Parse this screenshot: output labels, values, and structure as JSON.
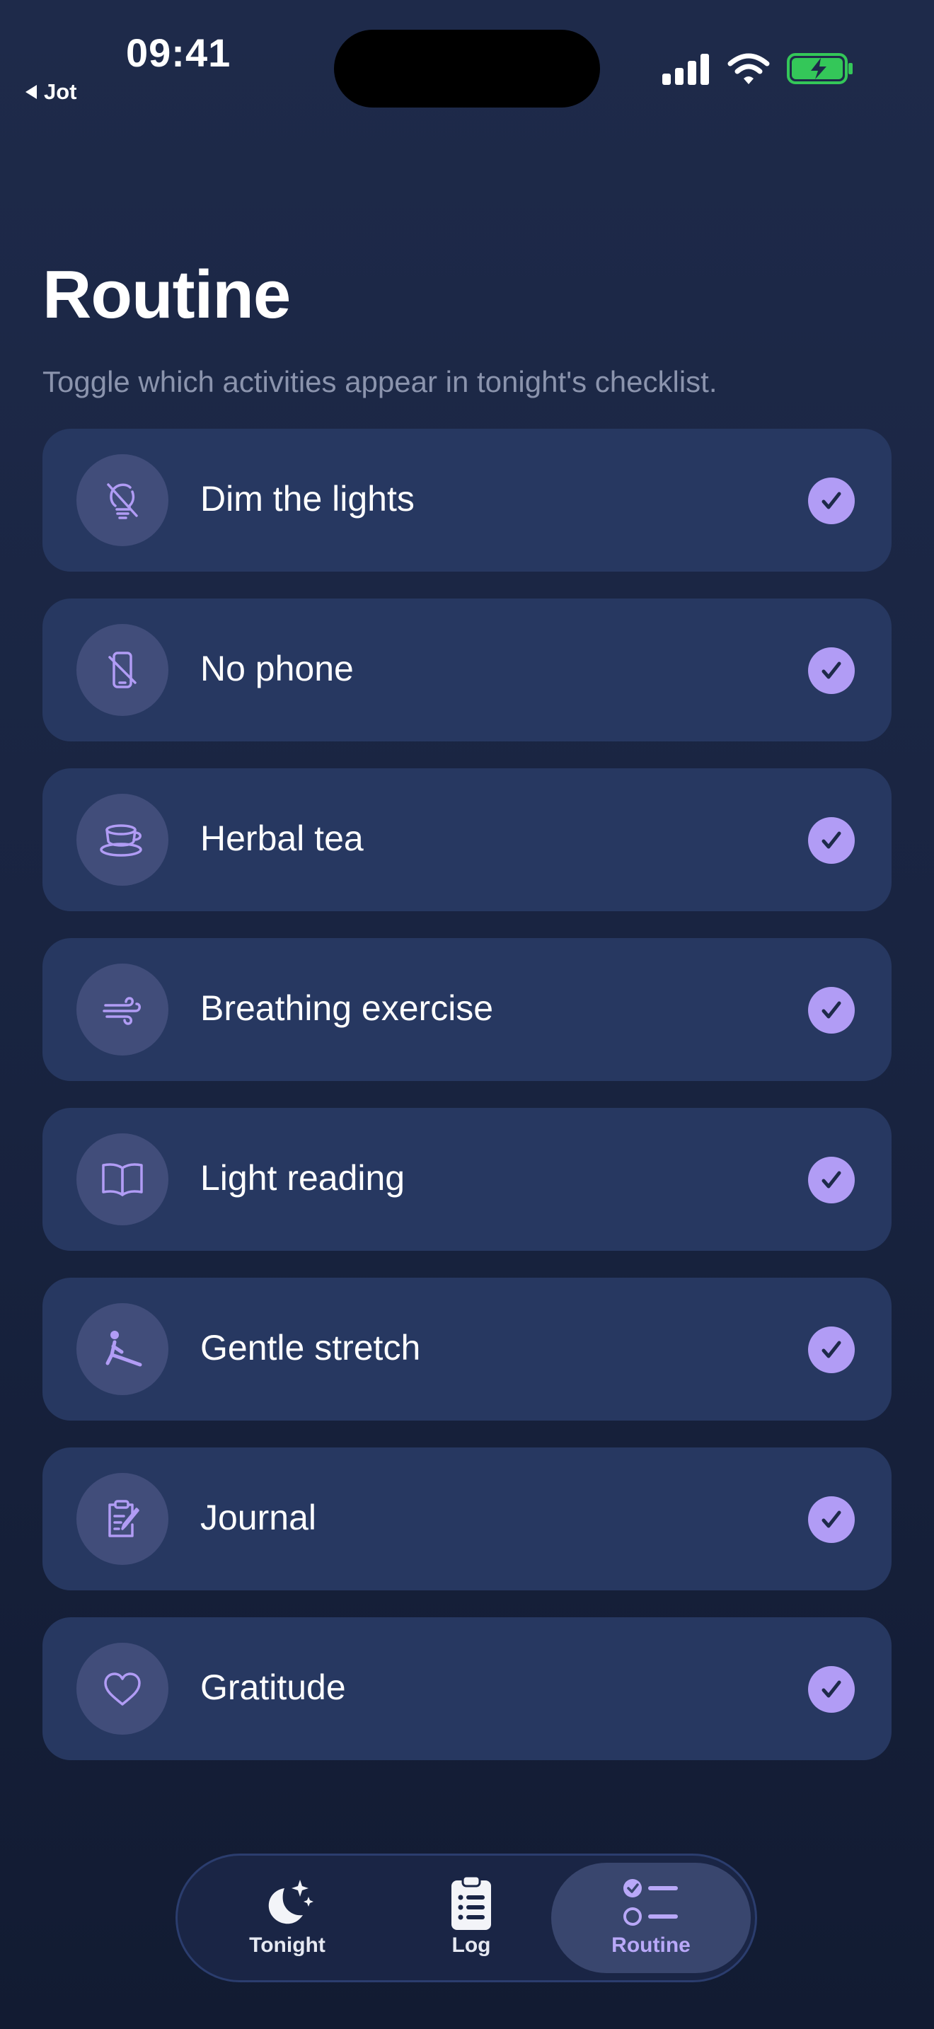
{
  "status_bar": {
    "time": "09:41",
    "back_label": "Jot"
  },
  "header": {
    "title": "Routine",
    "subtitle": "Toggle which activities appear in tonight's checklist."
  },
  "routine": {
    "items": [
      {
        "label": "Dim the lights",
        "icon": "lightbulb-slash-icon",
        "enabled": true
      },
      {
        "label": "No phone",
        "icon": "phone-slash-icon",
        "enabled": true
      },
      {
        "label": "Herbal tea",
        "icon": "teacup-icon",
        "enabled": true
      },
      {
        "label": "Breathing exercise",
        "icon": "wind-icon",
        "enabled": true
      },
      {
        "label": "Light reading",
        "icon": "book-icon",
        "enabled": true
      },
      {
        "label": "Gentle stretch",
        "icon": "stretch-figure-icon",
        "enabled": true
      },
      {
        "label": "Journal",
        "icon": "clipboard-pencil-icon",
        "enabled": true
      },
      {
        "label": "Gratitude",
        "icon": "heart-icon",
        "enabled": true
      }
    ]
  },
  "tab_bar": {
    "tabs": [
      {
        "label": "Tonight",
        "icon": "moon-stars-icon",
        "selected": false
      },
      {
        "label": "Log",
        "icon": "clipboard-list-icon",
        "selected": false
      },
      {
        "label": "Routine",
        "icon": "checklist-icon",
        "selected": true
      }
    ]
  },
  "colors": {
    "background": "#1e2a4a",
    "card": "#273861",
    "icon_circle": "#414d7a",
    "accent": "#b19cf5",
    "subtitle": "#8b94ad",
    "battery": "#34c759"
  }
}
